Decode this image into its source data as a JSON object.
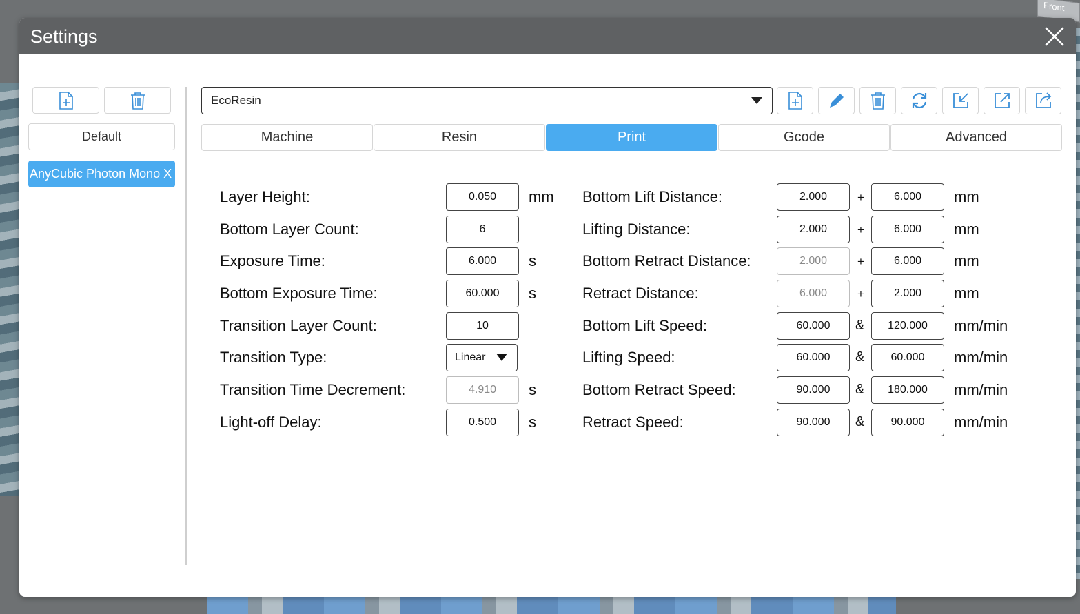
{
  "background": {
    "view_cube_label": "Front"
  },
  "dialog": {
    "title": "Settings"
  },
  "left_panel": {
    "presets": [
      {
        "label": "Default",
        "selected": false
      },
      {
        "label": "AnyCubic Photon Mono X",
        "selected": true
      }
    ]
  },
  "toolbar": {
    "resin_profile": "EcoResin",
    "buttons": [
      "new-file-icon",
      "edit-pencil-icon",
      "trash-icon",
      "refresh-icon",
      "import-icon",
      "export-icon",
      "share-icon"
    ]
  },
  "tabs": [
    {
      "label": "Machine",
      "active": false
    },
    {
      "label": "Resin",
      "active": false
    },
    {
      "label": "Print",
      "active": true
    },
    {
      "label": "Gcode",
      "active": false
    },
    {
      "label": "Advanced",
      "active": false
    }
  ],
  "print": {
    "left": [
      {
        "label": "Layer Height:",
        "value": "0.050",
        "unit": "mm"
      },
      {
        "label": "Bottom Layer Count:",
        "value": "6",
        "unit": ""
      },
      {
        "label": "Exposure Time:",
        "value": "6.000",
        "unit": "s"
      },
      {
        "label": "Bottom Exposure Time:",
        "value": "60.000",
        "unit": "s"
      },
      {
        "label": "Transition Layer Count:",
        "value": "10",
        "unit": ""
      },
      {
        "label": "Transition Type:",
        "value": "Linear",
        "unit": ""
      },
      {
        "label": "Transition Time Decrement:",
        "value": "4.910",
        "unit": "s"
      },
      {
        "label": "Light-off Delay:",
        "value": "0.500",
        "unit": "s"
      }
    ],
    "right": [
      {
        "label": "Bottom Lift Distance:",
        "value1": "2.000",
        "sep": "+",
        "value2": "6.000",
        "unit": "mm"
      },
      {
        "label": "Lifting Distance:",
        "value1": "2.000",
        "sep": "+",
        "value2": "6.000",
        "unit": "mm"
      },
      {
        "label": "Bottom Retract Distance:",
        "value1": "2.000",
        "sep": "+",
        "value2": "6.000",
        "unit": "mm"
      },
      {
        "label": "Retract Distance:",
        "value1": "6.000",
        "sep": "+",
        "value2": "2.000",
        "unit": "mm"
      },
      {
        "label": "Bottom Lift Speed:",
        "value1": "60.000",
        "sep": "&",
        "value2": "120.000",
        "unit": "mm/min"
      },
      {
        "label": "Lifting Speed:",
        "value1": "60.000",
        "sep": "&",
        "value2": "60.000",
        "unit": "mm/min"
      },
      {
        "label": "Bottom Retract Speed:",
        "value1": "90.000",
        "sep": "&",
        "value2": "180.000",
        "unit": "mm/min"
      },
      {
        "label": "Retract Speed:",
        "value1": "90.000",
        "sep": "&",
        "value2": "90.000",
        "unit": "mm/min"
      }
    ]
  }
}
